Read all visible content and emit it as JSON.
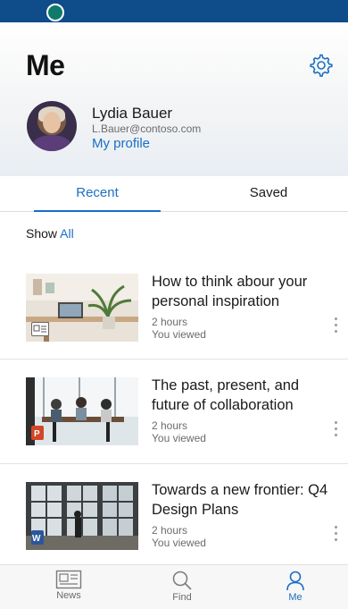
{
  "header": {
    "title": "Me"
  },
  "profile": {
    "name": "Lydia Bauer",
    "email": "L.Bauer@contoso.com",
    "link_label": "My profile"
  },
  "tabs": [
    {
      "label": "Recent",
      "active": true
    },
    {
      "label": "Saved",
      "active": false
    }
  ],
  "filter": {
    "prefix": "Show",
    "value": "All"
  },
  "items": [
    {
      "title": "How to think abour your personal inspiration",
      "time": "2 hours",
      "status": "You viewed",
      "type_icon": "news-icon",
      "badge_color": "#ffffff"
    },
    {
      "title": "The past, present, and future of collaboration",
      "time": "2 hours",
      "status": "You viewed",
      "type_icon": "powerpoint-icon",
      "badge_color": "#d24726"
    },
    {
      "title": "Towards a new frontier: Q4 Design Plans",
      "time": "2 hours",
      "status": "You viewed",
      "type_icon": "word-icon",
      "badge_color": "#2b579a"
    }
  ],
  "bottom_nav": [
    {
      "label": "News",
      "icon": "news-icon",
      "active": false
    },
    {
      "label": "Find",
      "icon": "search-icon",
      "active": false
    },
    {
      "label": "Me",
      "icon": "person-icon",
      "active": true
    }
  ],
  "colors": {
    "accent": "#1a6fc4",
    "topbar": "#0f4c8a"
  }
}
